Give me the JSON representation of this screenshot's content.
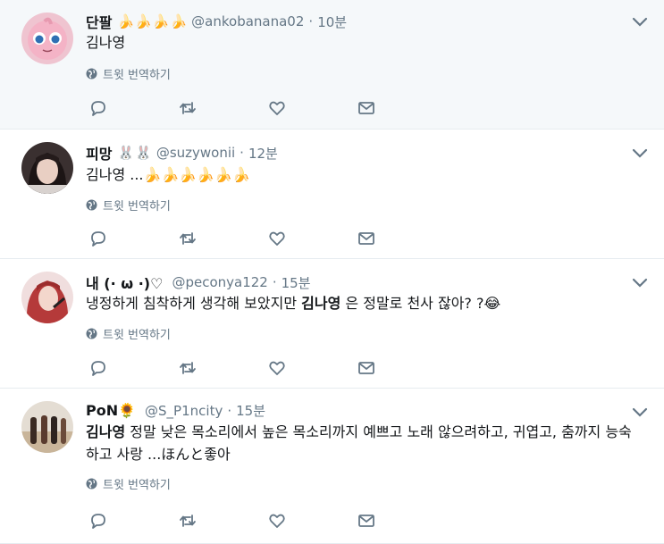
{
  "tweets": [
    {
      "name": "단팔",
      "emojis": "🍌🍌🍌🍌",
      "handle": "@ankobanana02",
      "time": "10분",
      "body_pre": "",
      "body_bold": "김나영",
      "body_post": "",
      "translate": "트윗 번역하기"
    },
    {
      "name": "피망",
      "emojis": "🐰🐰",
      "handle": "@suzywonii",
      "time": "12분",
      "body_pre": "",
      "body_bold": "김나영",
      "body_post": " ...🍌🍌🍌🍌🍌🍌",
      "translate": "트윗 번역하기"
    },
    {
      "name": "내 (· ω ·)♡",
      "emojis": "",
      "handle": "@peconya122",
      "time": "15분",
      "body_pre": "냉정하게 침착하게 생각해 보았지만 ",
      "body_bold": "김나영",
      "body_post": " 은 정말로 천사 잖아? ?😂",
      "translate": "트윗 번역하기"
    },
    {
      "name": "PoN🌻",
      "emojis": "",
      "handle": "@S_P1ncity",
      "time": "15분",
      "body_pre": "",
      "body_bold": "김나영",
      "body_post": " 정말 낮은 목소리에서 높은 목소리까지 예쁘고 노래 않으려하고, 귀엽고, 춤까지 능숙하고 사랑 ...ほんと좋아",
      "translate": "트윗 번역하기"
    }
  ],
  "colors": {
    "text": "#14171a",
    "secondary": "#657786",
    "highlight_bg": "#f5f8fa",
    "border": "#e6ecf0"
  }
}
